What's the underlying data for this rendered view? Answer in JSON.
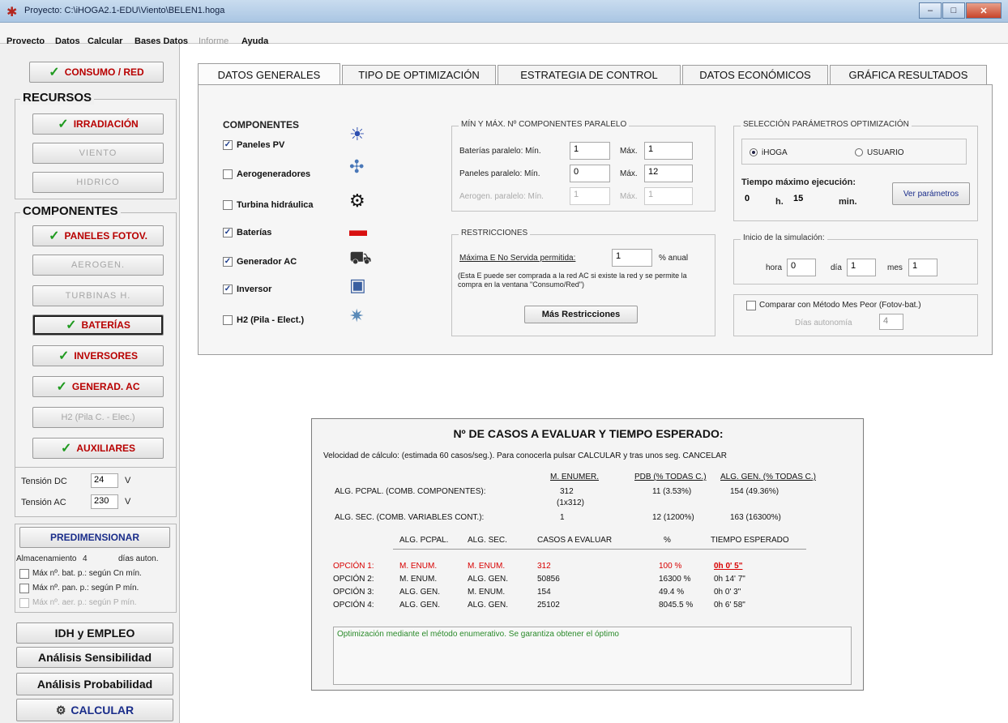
{
  "window": {
    "title": "Proyecto: C:\\iHOGA2.1-EDU\\Viento\\BELEN1.hoga",
    "controls": [
      "–",
      "□",
      "✕"
    ]
  },
  "menu": [
    {
      "label": "Proyecto",
      "enabled": true
    },
    {
      "label": "Datos",
      "enabled": true
    },
    {
      "label": "Calcular",
      "enabled": true
    },
    {
      "label": "Bases Datos",
      "enabled": true
    },
    {
      "label": "Informe",
      "enabled": false
    },
    {
      "label": "Ayuda",
      "enabled": true
    }
  ],
  "sidebar": {
    "consumo": "CONSUMO / RED",
    "recursos_title": "RECURSOS",
    "recursos": [
      "IRRADIACIÓN",
      "VIENTO",
      "HIDRICO"
    ],
    "componentes_title": "COMPONENTES",
    "componentes": [
      "PANELES FOTOV.",
      "AEROGEN.",
      "TURBINAS H.",
      "BATERÍAS",
      "INVERSORES",
      "GENERAD. AC",
      "H2 (Pila C. - Elec.)",
      "AUXILIARES"
    ],
    "tension_dc_label": "Tensión DC",
    "tension_dc": "24",
    "tension_ac_label": "Tensión AC",
    "tension_ac": "230",
    "unit_v": "V",
    "predim": "PREDIMENSIONAR",
    "almacenamiento_label": "Almacenamiento",
    "almacenamiento": "4",
    "dias_auton": "días auton.",
    "opt1": "Máx nº. bat. p.: según Cn mín.",
    "opt2": "Máx nº. pan. p.: según P mín.",
    "opt3": "Máx nº. aer. p.: según P mín.",
    "idh": "IDH y EMPLEO",
    "sens": "Análisis Sensibilidad",
    "prob": "Análisis Probabilidad",
    "calc": "CALCULAR",
    "check": "✓"
  },
  "tabs": [
    "DATOS GENERALES",
    "TIPO DE OPTIMIZACIÓN",
    "ESTRATEGIA DE CONTROL",
    "DATOS ECONÓMICOS",
    "GRÁFICA RESULTADOS"
  ],
  "componentes_box": {
    "title": "COMPONENTES",
    "items": [
      {
        "label": "Paneles PV",
        "checked": true,
        "icon": "☀"
      },
      {
        "label": "Aerogeneradores",
        "checked": false,
        "icon": "✣"
      },
      {
        "label": "Turbina hidráulica",
        "checked": false,
        "icon": "⚙"
      },
      {
        "label": "Baterías",
        "checked": true,
        "icon": "▬"
      },
      {
        "label": "Generador AC",
        "checked": true,
        "icon": "⛟"
      },
      {
        "label": "Inversor",
        "checked": true,
        "icon": "▣"
      },
      {
        "label": "H2 (Pila - Elect.)",
        "checked": false,
        "icon": "✷"
      }
    ]
  },
  "paralelo": {
    "title": "MÍN Y MÁX. Nº COMPONENTES PARALELO",
    "bat_label": "Baterías paralelo: Mín.",
    "bat_min": "1",
    "bat_max": "1",
    "pan_label": "Paneles paralelo: Mín.",
    "pan_min": "0",
    "pan_max": "12",
    "aer_label": "Aerogen. paralelo: Mín.",
    "aer_min": "1",
    "aer_max": "1",
    "max_label": "Máx."
  },
  "restricciones": {
    "title": "RESTRICCIONES",
    "label": "Máxima E No Servida permitida:",
    "value": "1",
    "unit": "% anual",
    "note": "(Esta E puede ser comprada a la red AC si existe la red y se permite la compra en la ventana \"Consumo/Red\")",
    "button": "Más Restricciones"
  },
  "seleccion": {
    "title": "SELECCIÓN PARÁMETROS OPTIMIZACIÓN",
    "opt_a": "iHOGA",
    "opt_b": "USUARIO",
    "tiempo_label": "Tiempo máximo ejecución:",
    "h": "0",
    "h_unit": "h.",
    "min": "15",
    "min_unit": "min.",
    "button": "Ver parámetros"
  },
  "inicio": {
    "title": "Inicio de la simulación:",
    "hora_label": "hora",
    "hora": "0",
    "dia_label": "día",
    "dia": "1",
    "mes_label": "mes",
    "mes": "1"
  },
  "comparar": {
    "label": "Comparar con Método Mes Peor (Fotov-bat.)",
    "dias_label": "Días autonomía",
    "dias": "4"
  },
  "casos": {
    "title": "Nº DE CASOS A EVALUAR Y TIEMPO ESPERADO:",
    "velocidad": "Velocidad de cálculo: (estimada 60 casos/seg.). Para conocerla pulsar CALCULAR y tras unos seg. CANCELAR",
    "headers": [
      "M. ENUMER.",
      "PDB (% TODAS C.)",
      "ALG. GEN. (% TODAS C.)"
    ],
    "rows": [
      {
        "label": "ALG. PCPAL. (COMB. COMPONENTES):",
        "c1": "312",
        "c1b": "(1x312)",
        "c2": "11 (3.53%)",
        "c3": "154 (49.36%)"
      },
      {
        "label": "ALG. SEC. (COMB. VARIABLES CONT.):",
        "c1": "1",
        "c1b": "",
        "c2": "12 (1200%)",
        "c3": "163 (16300%)"
      }
    ],
    "opt_headers": [
      "ALG. PCPAL.",
      "ALG. SEC.",
      "CASOS A EVALUAR",
      "%",
      "TIEMPO ESPERADO"
    ],
    "options": [
      {
        "name": "OPCIÓN 1:",
        "a": "M. ENUM.",
        "b": "M. ENUM.",
        "casos": "312",
        "pct": "100 %",
        "tiempo": "0h 0' 5\""
      },
      {
        "name": "OPCIÓN 2:",
        "a": "M. ENUM.",
        "b": "ALG. GEN.",
        "casos": "50856",
        "pct": "16300 %",
        "tiempo": "0h 14' 7\""
      },
      {
        "name": "OPCIÓN 3:",
        "a": "ALG. GEN.",
        "b": "M. ENUM.",
        "casos": "154",
        "pct": "49.4 %",
        "tiempo": "0h 0' 3\""
      },
      {
        "name": "OPCIÓN 4:",
        "a": "ALG. GEN.",
        "b": "ALG. GEN.",
        "casos": "25102",
        "pct": "8045.5 %",
        "tiempo": "0h 6' 58\""
      }
    ],
    "message": "Optimización mediante el método enumerativo. Se garantiza obtener el óptimo"
  }
}
